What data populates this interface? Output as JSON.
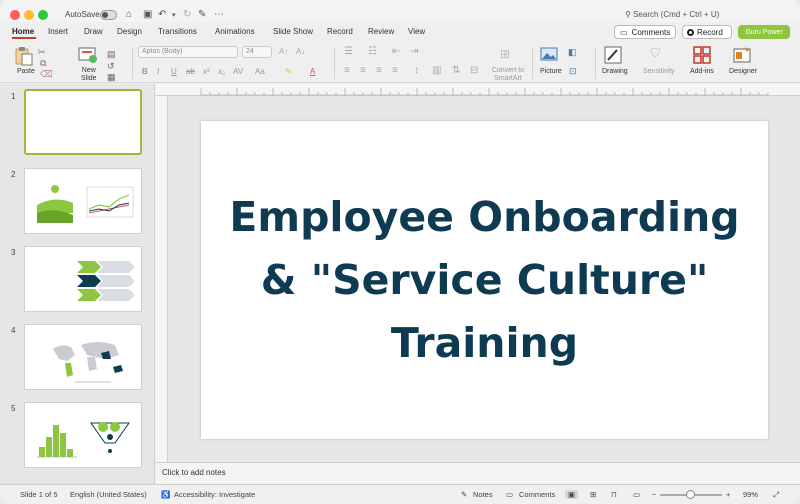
{
  "titlebar": {
    "autosave_label": "AutoSave",
    "search_placeholder": "Search (Cmd + Ctrl + U)"
  },
  "tabs": [
    "Home",
    "Insert",
    "Draw",
    "Design",
    "Transitions",
    "Animations",
    "Slide Show",
    "Record",
    "Review",
    "View"
  ],
  "active_tab": "Home",
  "actions": {
    "comments": "Comments",
    "record": "Record",
    "guru": "Guru Power"
  },
  "ribbon": {
    "paste": "Paste",
    "new_slide_line1": "New",
    "new_slide_line2": "Slide",
    "font_name": "Aptos (Body)",
    "font_size": "24",
    "convert_line1": "Convert to",
    "convert_line2": "SmartArt",
    "picture": "Picture",
    "drawing": "Drawing",
    "sensitivity": "Sensitivity",
    "addins": "Add-ins",
    "designer": "Designer"
  },
  "thumbnails": [
    {
      "number": "1",
      "kind": "blank"
    },
    {
      "number": "2",
      "kind": "landscape-chart"
    },
    {
      "number": "3",
      "kind": "chevrons"
    },
    {
      "number": "4",
      "kind": "world-map"
    },
    {
      "number": "5",
      "kind": "histogram-funnel"
    }
  ],
  "slide": {
    "title": "Employee Onboarding & \"Service Culture\" Training",
    "title_color": "#0e3a52"
  },
  "notes_placeholder": "Click to add notes",
  "status": {
    "slide_counter": "Slide 1 of 5",
    "language": "English (United States)",
    "accessibility": "Accessibility: Investigate",
    "notes": "Notes",
    "comments": "Comments",
    "zoom": "99%"
  },
  "colors": {
    "accent_green": "#8dc63f",
    "selection_border": "#a3b53a",
    "tab_underline": "#b7472a"
  }
}
